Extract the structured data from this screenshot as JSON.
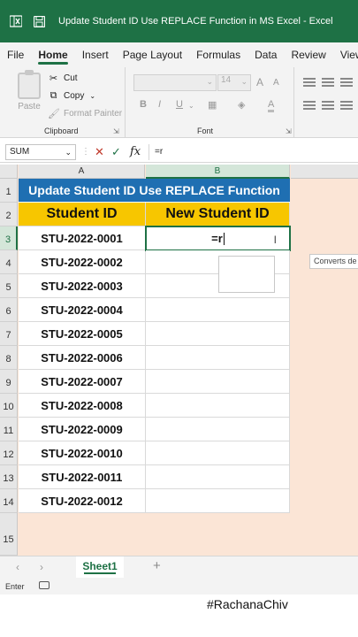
{
  "titlebar": {
    "title": "Update Student ID Use REPLACE Function in MS Excel  -  Excel",
    "app_icon": "excel-icon",
    "save_icon": "save-icon"
  },
  "ribbon_tabs": [
    "File",
    "Home",
    "Insert",
    "Page Layout",
    "Formulas",
    "Data",
    "Review",
    "View"
  ],
  "active_tab": "Home",
  "clipboard": {
    "paste": "Paste",
    "cut": "Cut",
    "copy": "Copy",
    "format_painter": "Format Painter",
    "group_label": "Clipboard"
  },
  "font_group": {
    "font_name": "",
    "font_size": "14",
    "bold": "B",
    "italic": "I",
    "underline": "U",
    "font_color": "A",
    "fill_color": "A",
    "grow": "A",
    "shrink": "A",
    "group_label": "Font"
  },
  "formula_bar": {
    "name_box": "SUM",
    "cancel": "✕",
    "enter": "✓",
    "fx": "fx",
    "content": "=r"
  },
  "columns": [
    "A",
    "B"
  ],
  "rows": [
    "1",
    "2",
    "3",
    "4",
    "5",
    "6",
    "7",
    "8",
    "9",
    "10",
    "11",
    "12",
    "13",
    "14",
    "15"
  ],
  "sheet": {
    "title": "Update Student ID Use REPLACE Function",
    "header_a": "Student ID",
    "header_b": "New Student ID",
    "active_cell_value": "=r",
    "student_ids": [
      "STU-2022-0001",
      "STU-2022-0002",
      "STU-2022-0003",
      "STU-2022-0004",
      "STU-2022-0005",
      "STU-2022-0006",
      "STU-2022-0007",
      "STU-2022-0008",
      "STU-2022-0009",
      "STU-2022-0010",
      "STU-2022-0011",
      "STU-2022-0012"
    ],
    "title_color": "#1f6fb2",
    "header_color": "#f7c600",
    "background_color": "#fbe5d6"
  },
  "tooltip": "Converts de",
  "sheet_tabs": {
    "active": "Sheet1",
    "add": "+"
  },
  "status": {
    "mode": "Enter"
  },
  "watermark": "#RachanaChiv"
}
